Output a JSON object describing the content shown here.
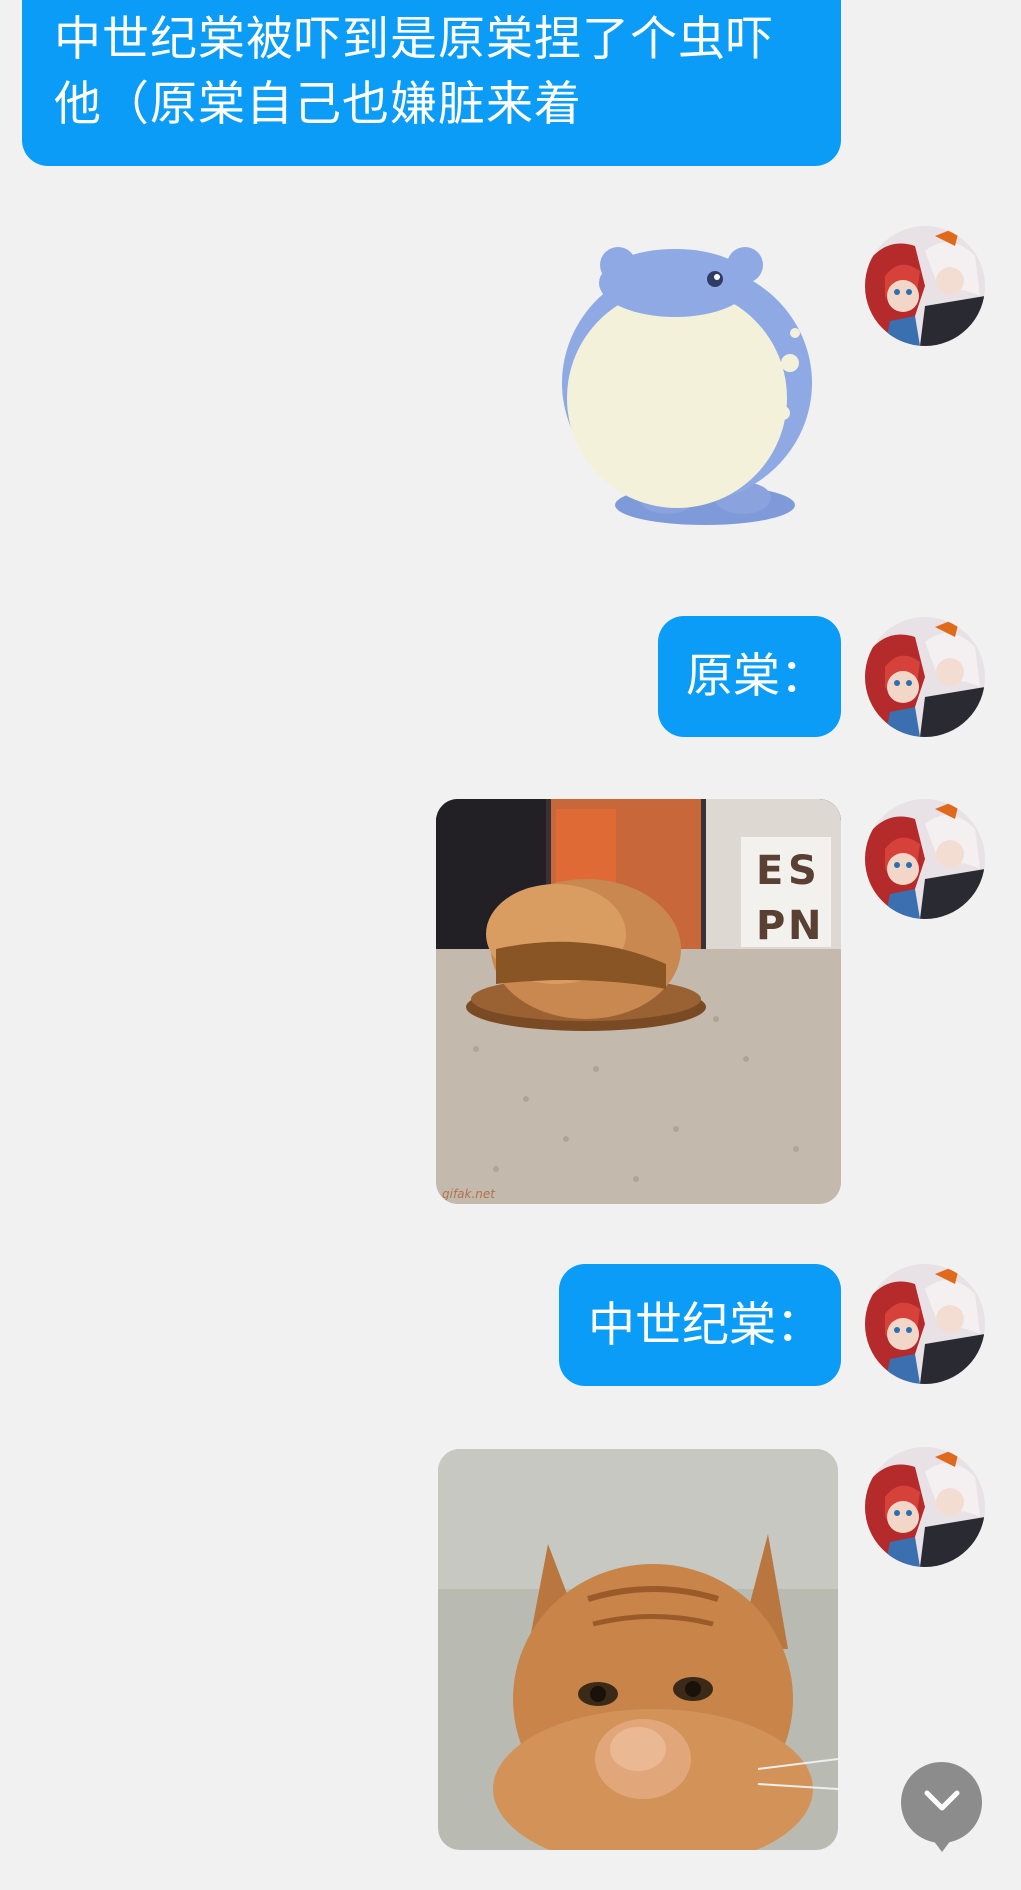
{
  "messages": [
    {
      "type": "text",
      "lines": [
        "中世纪棠被吓到是原棠捏了个虫吓",
        "他（原棠自己也嫌脏来着"
      ]
    },
    {
      "type": "sticker",
      "icon": "blue-round-creature-sticker"
    },
    {
      "type": "text",
      "text": "原棠："
    },
    {
      "type": "image",
      "icon": "cat-in-slipper-gif"
    },
    {
      "type": "text",
      "text": "中世纪棠："
    },
    {
      "type": "image",
      "icon": "orange-cat-paw-gif"
    }
  ],
  "media_1": {
    "watermark": "gifak.net",
    "book_letters": [
      "E",
      "S",
      "P",
      "N"
    ]
  },
  "scroll_button": {
    "icon": "chevron-down-icon"
  },
  "colors": {
    "background": "#f1f1f1",
    "bubble": "#0a9cf6",
    "bubble_text": "#ffffff",
    "scroll_button": "#8c8c8c"
  }
}
